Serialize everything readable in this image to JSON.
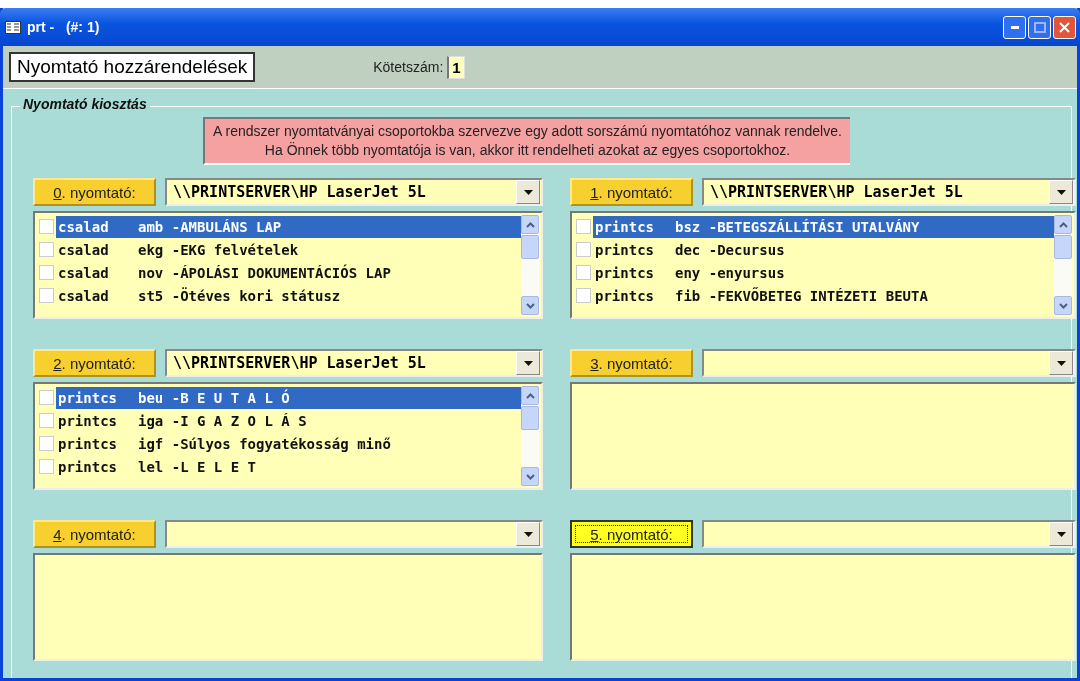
{
  "window": {
    "title": "prt -   (#: 1)"
  },
  "header": {
    "title": "Nyomtató hozzárendelések",
    "volume_label": "Kötetszám:",
    "volume_value": "1"
  },
  "group": {
    "legend": "Nyomtató kiosztás",
    "notice": [
      "A rendszer nyomtatványai csoportokba szervezve egy adott sorszámú nyomtatóhoz vannak rendelve.",
      "Ha Önnek több nyomtatója is van, akkor itt rendelheti azokat az egyes csoportokhoz."
    ]
  },
  "printers": [
    {
      "button": "0. nyomtató:",
      "focused": false,
      "printer": "\\\\PRINTSERVER\\HP LaserJet 5L",
      "items": [
        {
          "group": "csalad",
          "entry": "amb -AMBULÁNS LAP",
          "checked": false,
          "selected": true
        },
        {
          "group": "csalad",
          "entry": "ekg -EKG felvételek",
          "checked": false,
          "selected": false
        },
        {
          "group": "csalad",
          "entry": "nov -ÁPOLÁSI DOKUMENTÁCIÓS LAP",
          "checked": false,
          "selected": false
        },
        {
          "group": "csalad",
          "entry": "st5 -Ötéves kori státusz",
          "checked": false,
          "selected": false
        }
      ]
    },
    {
      "button": "1. nyomtató:",
      "focused": false,
      "printer": "\\\\PRINTSERVER\\HP LaserJet 5L",
      "items": [
        {
          "group": "printcs",
          "entry": "bsz -BETEGSZÁLLÍTÁSI UTALVÁNY",
          "checked": false,
          "selected": true
        },
        {
          "group": "printcs",
          "entry": "dec -Decursus",
          "checked": false,
          "selected": false
        },
        {
          "group": "printcs",
          "entry": "eny -enyursus",
          "checked": false,
          "selected": false
        },
        {
          "group": "printcs",
          "entry": "fib -FEKVŐBETEG INTÉZETI BEUTA",
          "checked": false,
          "selected": false
        }
      ]
    },
    {
      "button": "2. nyomtató:",
      "focused": false,
      "printer": "\\\\PRINTSERVER\\HP LaserJet 5L",
      "items": [
        {
          "group": "printcs",
          "entry": "beu -B E U T A L Ó",
          "checked": false,
          "selected": true
        },
        {
          "group": "printcs",
          "entry": "iga -I G A Z O L Á S",
          "checked": false,
          "selected": false
        },
        {
          "group": "printcs",
          "entry": "igf -Súlyos fogyatékosság minő",
          "checked": false,
          "selected": false
        },
        {
          "group": "printcs",
          "entry": "lel -L E L E T",
          "checked": false,
          "selected": false
        }
      ]
    },
    {
      "button": "3. nyomtató:",
      "focused": false
    },
    {
      "button": "4. nyomtató:",
      "focused": false
    },
    {
      "button": "5. nyomtató:",
      "focused": true
    }
  ]
}
